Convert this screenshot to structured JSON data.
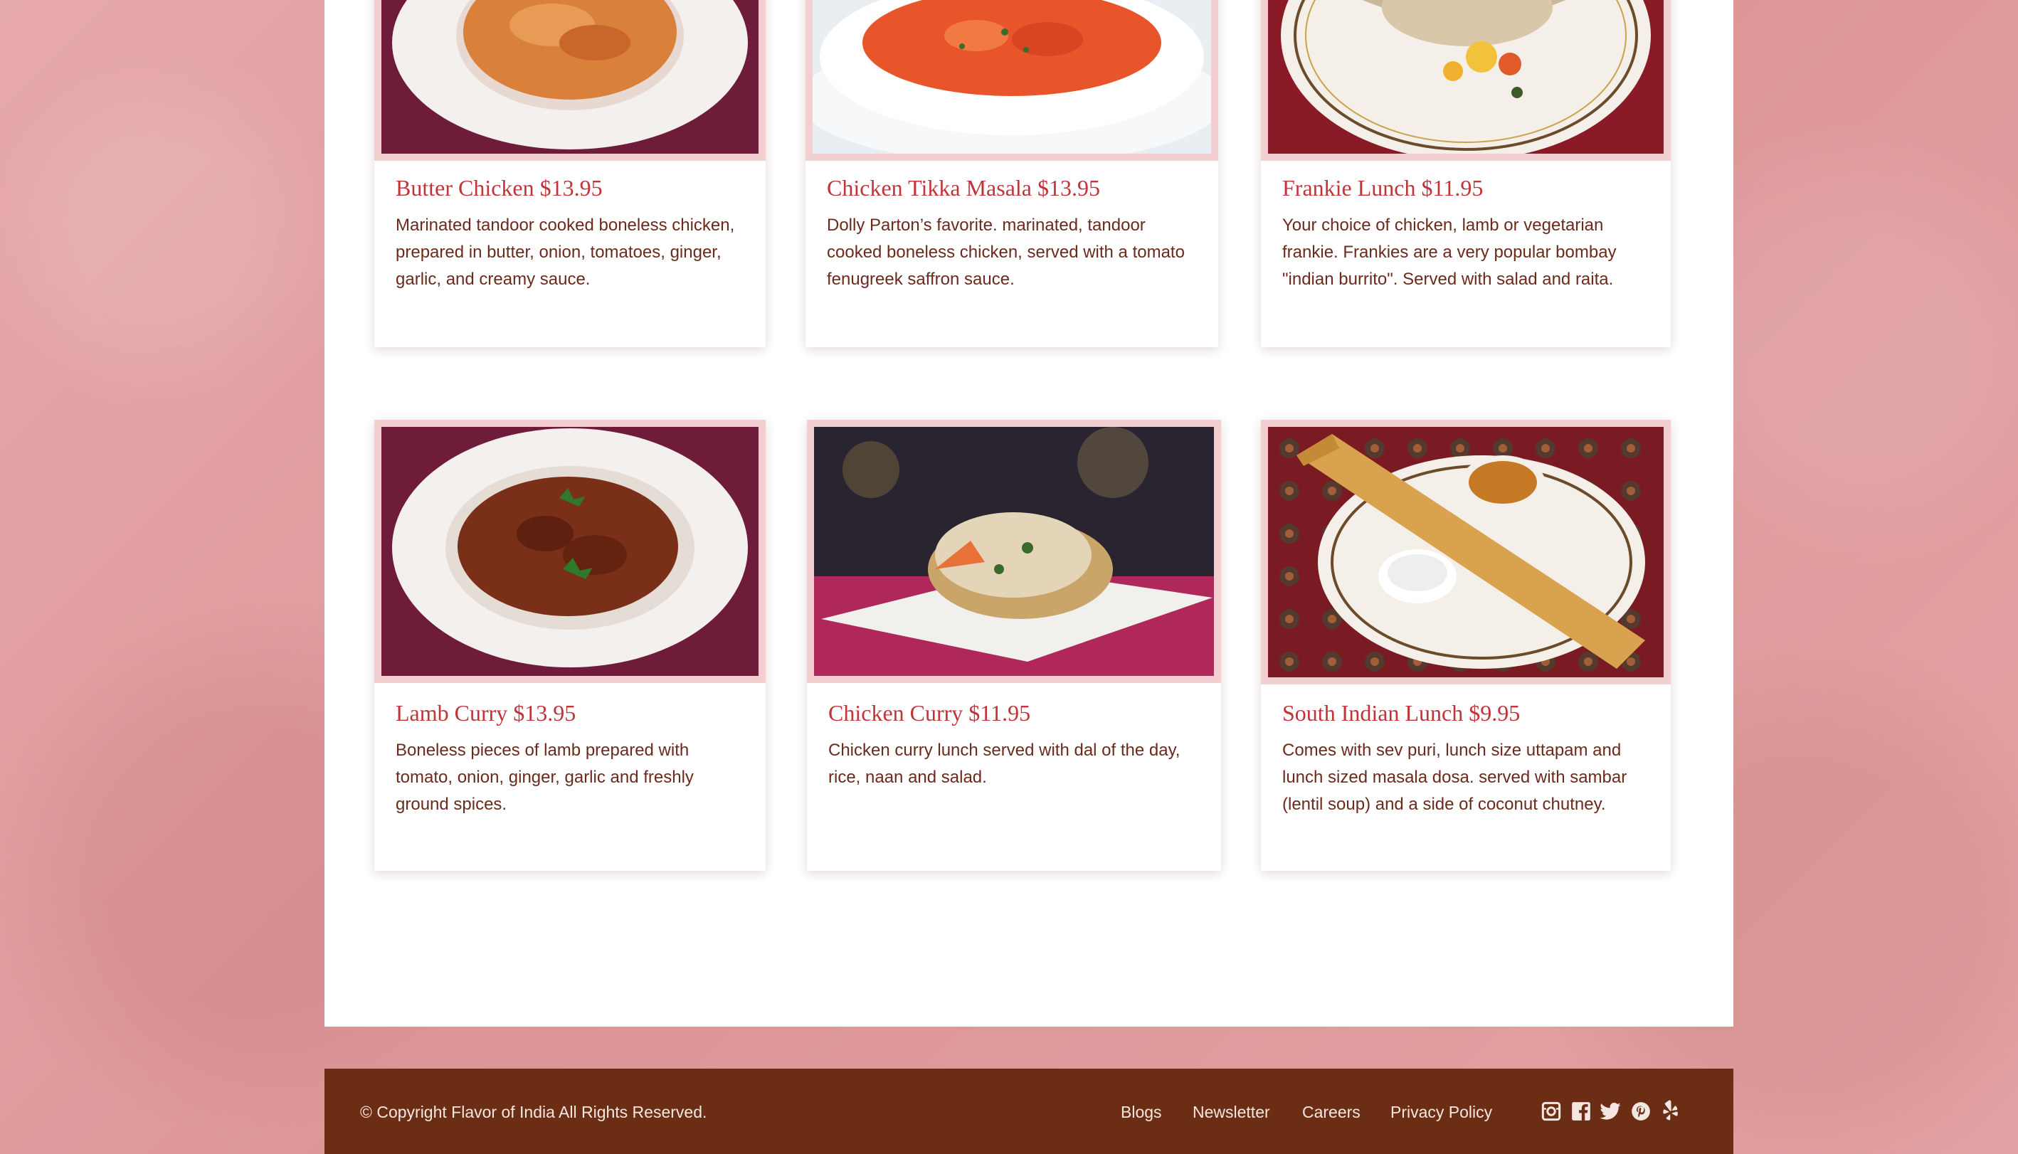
{
  "menu": {
    "items": [
      {
        "title": "Butter Chicken $13.95",
        "description": "Marinated tandoor cooked boneless chicken, prepared in butter, onion, tomatoes, ginger, garlic, and creamy sauce."
      },
      {
        "title": "Chicken Tikka Masala $13.95",
        "description": "Dolly Parton’s favorite. marinated, tandoor cooked boneless chicken, served with a tomato fenugreek saffron sauce."
      },
      {
        "title": "Frankie Lunch $11.95",
        "description": "Your choice of chicken, lamb or vegetarian frankie. Frankies are a very popular bombay \"indian burrito\". Served with salad and raita."
      },
      {
        "title": "Lamb Curry $13.95",
        "description": "Boneless pieces of lamb prepared with tomato, onion, ginger, garlic and freshly ground spices."
      },
      {
        "title": "Chicken Curry $11.95",
        "description": "Chicken curry lunch served with dal of the day, rice, naan and salad."
      },
      {
        "title": "South Indian Lunch $9.95",
        "description": "Comes with sev puri, lunch size uttapam and lunch sized masala dosa. served with sambar (lentil soup) and a side of coconut chutney."
      }
    ]
  },
  "footer": {
    "copyright": "© Copyright Flavor of India All Rights Reserved.",
    "links": [
      "Blogs",
      "Newsletter",
      "Careers",
      "Privacy Policy"
    ],
    "social": [
      "instagram-icon",
      "facebook-icon",
      "twitter-icon",
      "pinterest-icon",
      "yelp-icon"
    ]
  },
  "colors": {
    "title": "#c0343a",
    "text": "#6b2a1c",
    "footer_bg": "#6b2d13",
    "photo_frame": "#f4cfd1",
    "page_bg": "#e2a1a3"
  }
}
